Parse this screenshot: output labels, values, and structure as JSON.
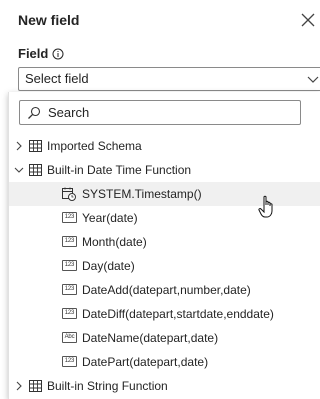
{
  "panel": {
    "title": "New field"
  },
  "field": {
    "label": "Field",
    "select_value": "Select field"
  },
  "search": {
    "placeholder": "Search"
  },
  "tree": {
    "groups": [
      {
        "label": "Imported Schema",
        "expanded": false
      },
      {
        "label": "Built-in Date Time Function",
        "expanded": true
      },
      {
        "label": "Built-in String Function",
        "expanded": false
      }
    ],
    "items": [
      {
        "label": "SYSTEM.Timestamp()",
        "icon": "calendar-clock-icon"
      },
      {
        "label": "Year(date)",
        "badge": "123"
      },
      {
        "label": "Month(date)",
        "badge": "123"
      },
      {
        "label": "Day(date)",
        "badge": "123"
      },
      {
        "label": "DateAdd(datepart,number,date)",
        "badge": "123"
      },
      {
        "label": "DateDiff(datepart,startdate,enddate)",
        "badge": "123"
      },
      {
        "label": "DateName(datepart,date)",
        "badge": "Abc"
      },
      {
        "label": "DatePart(datepart,date)",
        "badge": "123"
      }
    ]
  }
}
